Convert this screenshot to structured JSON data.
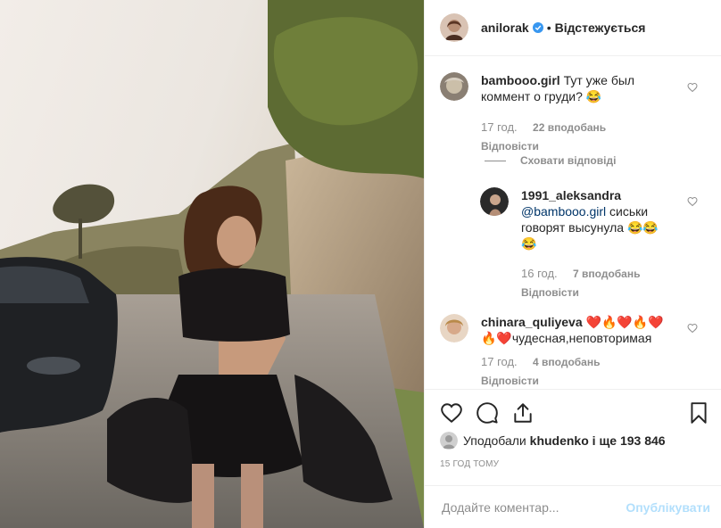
{
  "post": {
    "author": "anilorak",
    "separator": "•",
    "follow_label": "Відстежується"
  },
  "comments": [
    {
      "username": "bambooo.girl",
      "text": "Тут уже был коммент о груди?",
      "emoji": "😂",
      "time": "17 год.",
      "likes": "22 вподобань",
      "reply_label": "Відповісти"
    },
    {
      "hide_replies_label": "Сховати відповіді"
    },
    {
      "username": "1991_aleksandra",
      "mention": "@bambooo.girl",
      "text": "сиськи говорят высунула",
      "emoji_inline": "😂😂",
      "emoji_line": "😂",
      "time": "16 год.",
      "likes": "7 вподобань",
      "reply_label": "Відповісти"
    },
    {
      "username": "chinara_quliyeva",
      "emoji_line": "❤️🔥❤️🔥❤️",
      "emoji_inline": "🔥❤️",
      "text": "чудесная,неповторимая",
      "time": "17 год.",
      "likes": "4 вподобань",
      "reply_label": "Відповісти"
    }
  ],
  "likes_row": {
    "prefix": "Уподобали",
    "user": "khudenko",
    "suffix": "і ще 193 846"
  },
  "time_ago": "15 ГОД ТОМУ",
  "comment_box": {
    "placeholder": "Додайте коментар...",
    "publish_label": "Опублікувати"
  },
  "icons": [
    "verified-icon",
    "heart-icon",
    "comment-icon",
    "share-icon",
    "bookmark-icon"
  ],
  "colors": {
    "accent": "#3897f0",
    "muted": "#8e8e8e",
    "publish_disabled": "#b2dffc",
    "text": "#262626"
  }
}
